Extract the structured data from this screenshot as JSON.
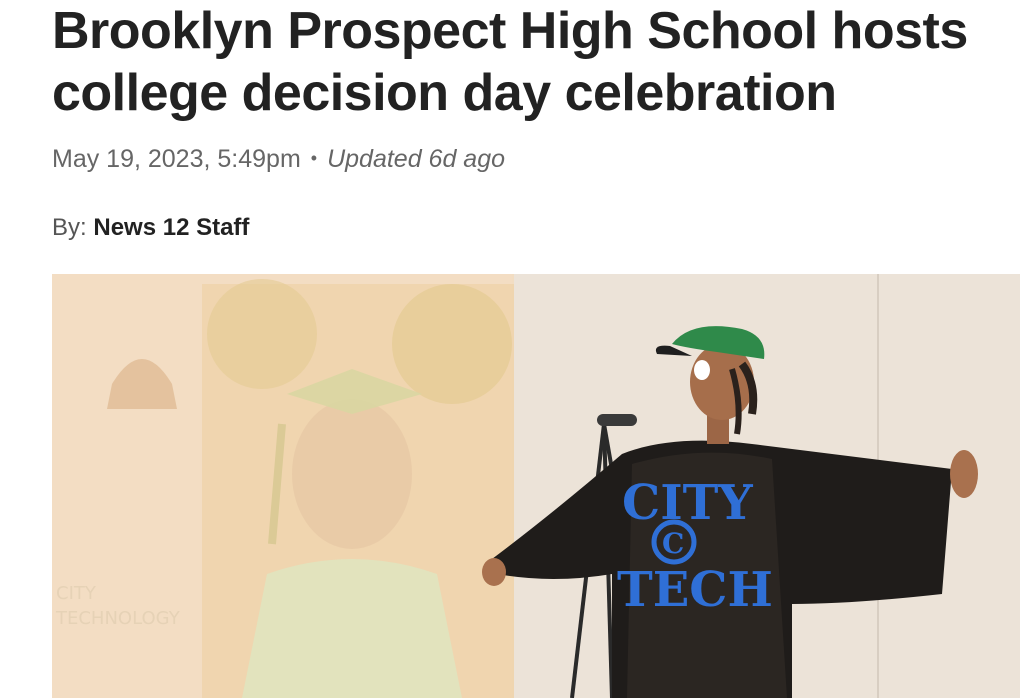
{
  "article": {
    "headline": "Brooklyn Prospect High School hosts college decision day celebration",
    "published": "May 19, 2023, 5:49pm",
    "separator": "•",
    "updated": "Updated 6d ago",
    "byline_prefix": "By:",
    "author": "News 12 Staff"
  },
  "photo": {
    "shirt_text_top": "CITY",
    "shirt_text_bottom": "TECH",
    "shirt_logo": "C",
    "screen_text_top": "CITY",
    "screen_text_bottom": "TECHNOLOGY",
    "colors": {
      "wall": "#efe6dc",
      "shirt": "#2b2622",
      "shirt_print": "#2f6fd6",
      "cap": "#2f8a4a",
      "screen_tint": "#f3dcc0"
    }
  }
}
